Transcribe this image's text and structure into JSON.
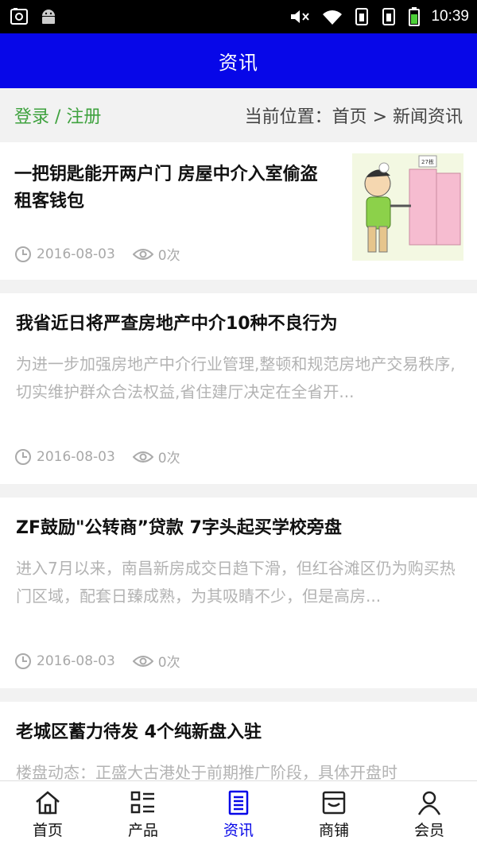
{
  "status_bar": {
    "time": "10:39"
  },
  "header": {
    "title": "资讯"
  },
  "breadcrumb": {
    "login_register": "登录 / 注册",
    "location": "当前位置：首页 > 新闻资讯"
  },
  "news": [
    {
      "title": "一把钥匙能开两户门 房屋中介入室偷盗租客钱包",
      "date": "2016-08-03",
      "views": "0次",
      "door_label": "27栋"
    },
    {
      "title": "我省近日将严查房地产中介10种不良行为",
      "desc": "为进一步加强房地产中介行业管理,整顿和规范房地产交易秩序,切实维护群众合法权益,省住建厅决定在全省开...",
      "date": "2016-08-03",
      "views": "0次"
    },
    {
      "title": "ZF鼓励\"公转商”贷款 7字头起买学校旁盘",
      "desc": "进入7月以来，南昌新房成交日趋下滑，但红谷滩区仍为购买热门区域，配套日臻成熟，为其吸睛不少，但是高房...",
      "date": "2016-08-03",
      "views": "0次"
    },
    {
      "title": "老城区蓄力待发 4个纯新盘入驻",
      "desc": "楼盘动态：正盛大古港处于前期推广阶段，具体开盘时"
    }
  ],
  "bottom_nav": {
    "home": "首页",
    "products": "产品",
    "news": "资讯",
    "shops": "商铺",
    "member": "会员"
  },
  "colors": {
    "header_bg": "#0707e8",
    "active_nav": "#0707e8",
    "login_green": "#3fa23f"
  }
}
